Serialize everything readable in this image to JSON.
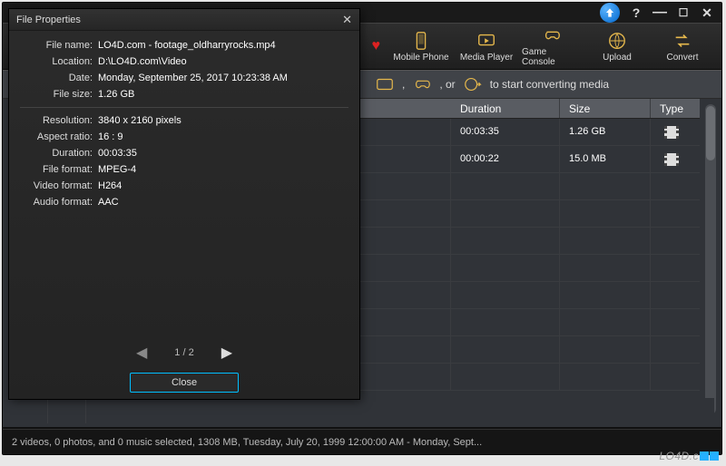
{
  "titlebar": {
    "help": "?",
    "minimize": "—",
    "maximize": "☐",
    "close": "✕"
  },
  "appbar": {
    "items": [
      {
        "label": "Mobile Phone"
      },
      {
        "label": "Media Player"
      },
      {
        "label": "Game Console"
      },
      {
        "label": "Upload"
      },
      {
        "label": "Convert"
      }
    ]
  },
  "hint": {
    "sep1": ",",
    "sep2": ", or",
    "tail": "to start converting media"
  },
  "table": {
    "columns": {
      "duration": "Duration",
      "size": "Size",
      "type": "Type"
    },
    "rows": [
      {
        "duration": "00:03:35",
        "size": "1.26 GB"
      },
      {
        "duration": "00:00:22",
        "size": "15.0 MB"
      }
    ]
  },
  "dialog": {
    "title": "File Properties",
    "props_top": [
      {
        "label": "File name:",
        "value": "LO4D.com - footage_oldharryrocks.mp4"
      },
      {
        "label": "Location:",
        "value": "D:\\LO4D.com\\Video"
      },
      {
        "label": "Date:",
        "value": "Monday, September 25, 2017 10:23:38 AM"
      },
      {
        "label": "File size:",
        "value": "1.26 GB"
      }
    ],
    "props_bottom": [
      {
        "label": "Resolution:",
        "value": "3840 x 2160 pixels"
      },
      {
        "label": "Aspect ratio:",
        "value": "16 : 9"
      },
      {
        "label": "Duration:",
        "value": "00:03:35"
      },
      {
        "label": "File format:",
        "value": "MPEG-4"
      },
      {
        "label": "Video format:",
        "value": "H264"
      },
      {
        "label": "Audio format:",
        "value": "AAC"
      }
    ],
    "pager": "1 / 2",
    "close_label": "Close"
  },
  "status": "2 videos, 0 photos, and 0 music selected, 1308 MB, Tuesday, July 20, 1999 12:00:00 AM - Monday, Sept...",
  "watermark": "LO4D.c",
  "colors": {
    "accent": "#e6b84c",
    "focus": "#00bfff"
  }
}
